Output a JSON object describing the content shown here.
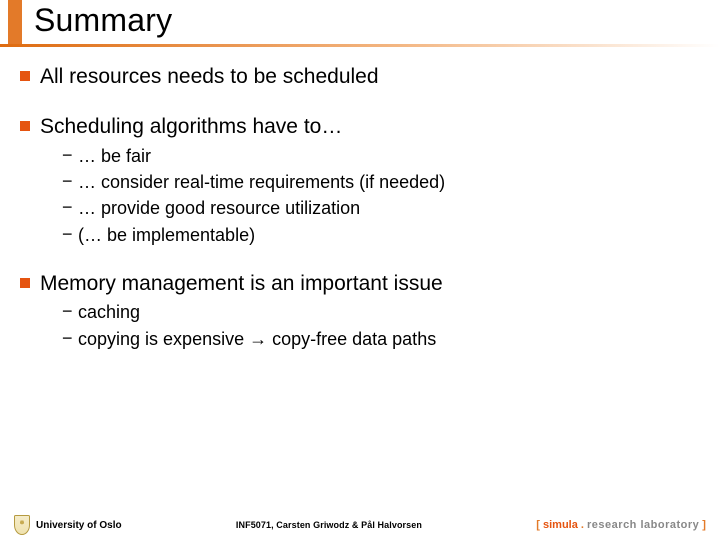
{
  "title": "Summary",
  "bullets": [
    {
      "text": "All resources needs to be scheduled",
      "subs": []
    },
    {
      "text": "Scheduling algorithms have to…",
      "subs": [
        "… be fair",
        "… consider real-time requirements (if needed)",
        "… provide good resource utilization",
        "(… be implementable)"
      ]
    },
    {
      "text": "Memory management is an important issue",
      "subs": [
        "caching",
        "copying is expensive → copy-free data paths"
      ]
    }
  ],
  "footer": {
    "left": "University of Oslo",
    "center": "INF5071, Carsten Griwodz & Pål Halvorsen",
    "right": {
      "bracket_open": "[ ",
      "simula": "simula",
      "dot": " . ",
      "rest": "research laboratory",
      "bracket_close": " ]"
    }
  }
}
